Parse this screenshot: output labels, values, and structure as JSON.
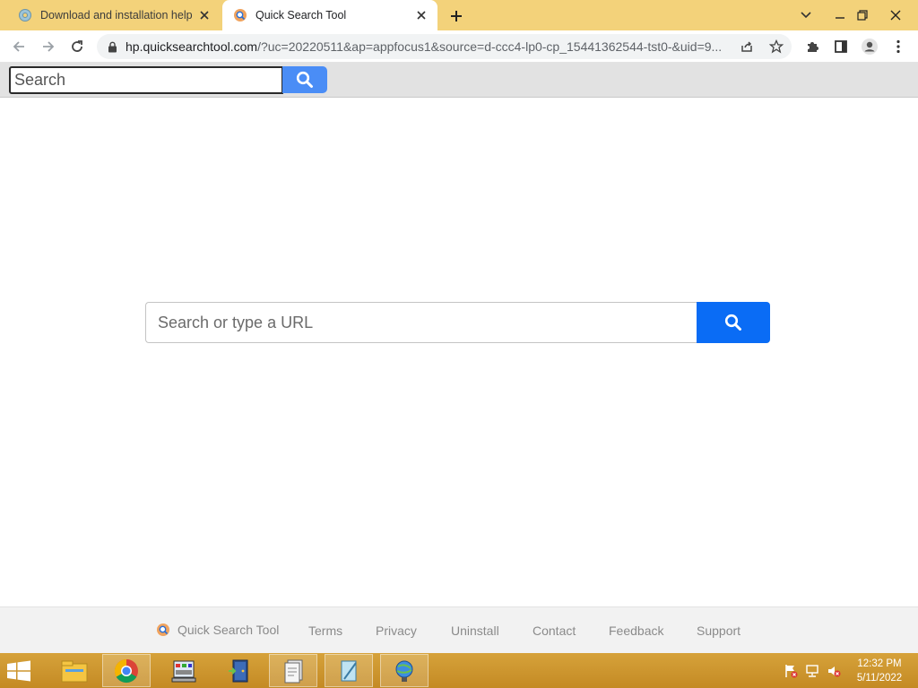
{
  "browser": {
    "tabs": [
      {
        "title": "Download and installation help",
        "active": false,
        "favicon": "gear-globe-icon"
      },
      {
        "title": "Quick Search Tool",
        "active": true,
        "favicon": "quick-search-tool-logo-icon"
      }
    ],
    "url_host": "hp.quicksearchtool.com",
    "url_path": "/?uc=20220511&ap=appfocus1&source=d-ccc4-lp0-cp_15441362544-tst0-&uid=9..."
  },
  "extension_bar": {
    "search_placeholder": "Search"
  },
  "main_search": {
    "placeholder": "Search or type a URL"
  },
  "footer": {
    "brand": "Quick Search Tool",
    "links": [
      "Terms",
      "Privacy",
      "Uninstall",
      "Contact",
      "Feedback",
      "Support"
    ]
  },
  "taskbar": {
    "apps": [
      "file-explorer-icon",
      "chrome-icon",
      "control-panel-icon",
      "door-exit-icon",
      "document-stack-icon",
      "notepad-icon",
      "network-globe-icon"
    ],
    "time": "12:32 PM",
    "date": "5/11/2022"
  },
  "colors": {
    "tab_strip": "#f3d27a",
    "search_button": "#0a6cf5",
    "extension_search_button": "#4a8df6",
    "taskbar": "#c48a24"
  }
}
